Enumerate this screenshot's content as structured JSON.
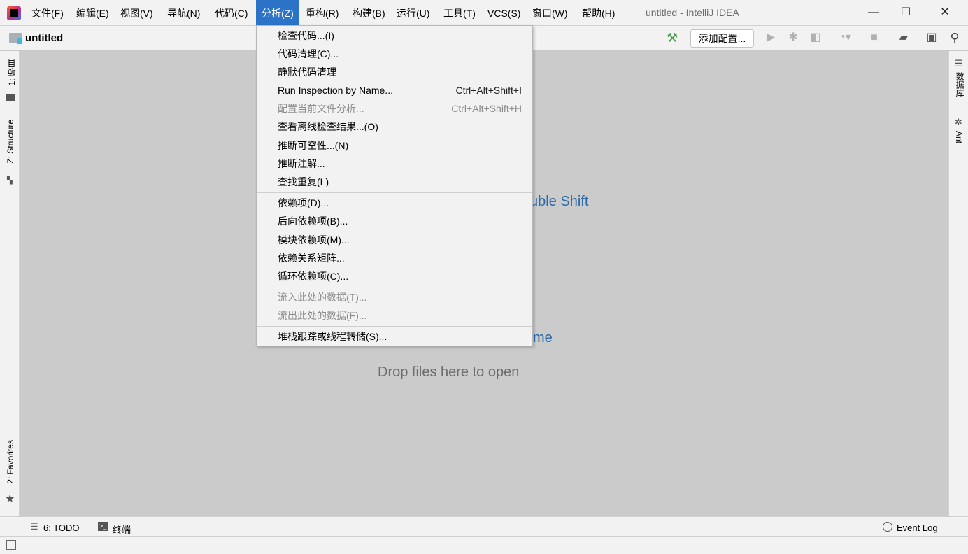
{
  "app_title": "untitled - IntelliJ IDEA",
  "menubar": [
    {
      "label": "文件(F)"
    },
    {
      "label": "编辑(E)"
    },
    {
      "label": "视图(V)"
    },
    {
      "label": "导航(N)"
    },
    {
      "label": "代码(C)"
    },
    {
      "label": "分析(Z)",
      "active": true
    },
    {
      "label": "重构(R)"
    },
    {
      "label": "构建(B)"
    },
    {
      "label": "运行(U)"
    },
    {
      "label": "工具(T)"
    },
    {
      "label": "VCS(S)"
    },
    {
      "label": "窗口(W)"
    },
    {
      "label": "帮助(H)"
    }
  ],
  "window_controls": {
    "minimize": "—",
    "maximize": "☐",
    "close": "✕"
  },
  "navbar": {
    "project": "untitled",
    "add_config": "添加配置..."
  },
  "left_tools": {
    "project": "1: 项目",
    "structure": "Z: Structure",
    "favorites": "2: Favorites"
  },
  "right_tools": {
    "database": "数据库",
    "ant": "Ant"
  },
  "analyze_menu": [
    {
      "label": "检查代码...(I)",
      "shortcut": ""
    },
    {
      "label": "代码清理(C)...",
      "shortcut": ""
    },
    {
      "label": "静默代码清理",
      "shortcut": ""
    },
    {
      "label": "Run Inspection by Name...",
      "shortcut": "Ctrl+Alt+Shift+I"
    },
    {
      "label": "配置当前文件分析...",
      "shortcut": "Ctrl+Alt+Shift+H",
      "disabled": true
    },
    {
      "label": "查看离线检查结果...(O)",
      "shortcut": ""
    },
    {
      "label": "推断可空性...(N)",
      "shortcut": ""
    },
    {
      "label": "推断注解...",
      "shortcut": ""
    },
    {
      "label": "查找重复(L)",
      "shortcut": ""
    },
    {
      "label": "依赖项(D)...",
      "shortcut": ""
    },
    {
      "label": "后向依赖项(B)...",
      "shortcut": ""
    },
    {
      "label": "模块依赖项(M)...",
      "shortcut": ""
    },
    {
      "label": "依赖关系矩阵...",
      "shortcut": ""
    },
    {
      "label": "循环依赖项(C)...",
      "shortcut": ""
    },
    {
      "label": "流入此处的数据(T)...",
      "shortcut": "",
      "disabled": true
    },
    {
      "label": "流出此处的数据(F)...",
      "shortcut": "",
      "disabled": true
    },
    {
      "label": "堆栈跟踪或线程转储(S)...",
      "shortcut": ""
    }
  ],
  "editor_hints": {
    "hint1_visible": "uble Shift",
    "hint2_visible": "me",
    "drop": "Drop files here to open"
  },
  "bottom_tools": {
    "todo": "6: TODO",
    "terminal": "终端",
    "event_log": "Event Log"
  },
  "colors": {
    "accent": "#2b73c7",
    "hint_link": "#2d6aa8",
    "editor_bg": "#cbcbcb"
  }
}
